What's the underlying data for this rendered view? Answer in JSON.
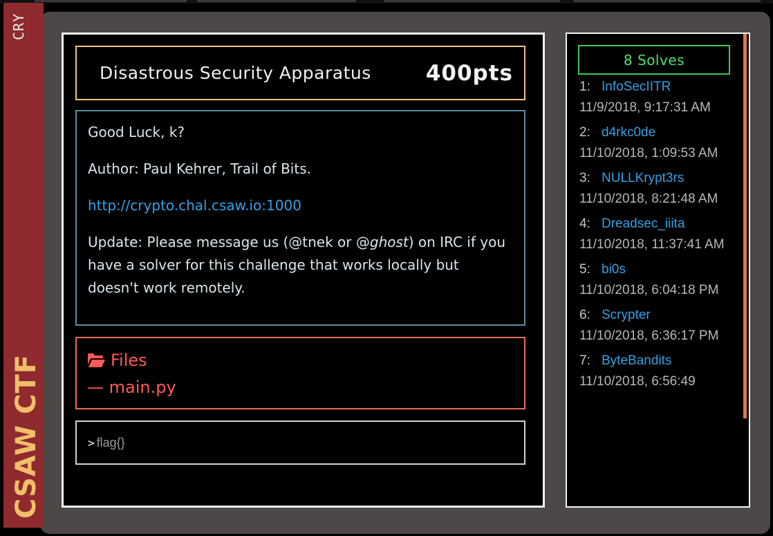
{
  "category": {
    "short": "CRY",
    "brand": "CSAW CTF"
  },
  "challenge": {
    "name": "Disastrous Security Apparatus",
    "points": "400pts",
    "description": {
      "line1": "Good Luck, k?",
      "line2": "Author: Paul Kehrer, Trail of Bits.",
      "link": "http://crypto.chal.csaw.io:1000",
      "update_before": "Update: Please message us (@tnek or @",
      "update_italic": "ghost",
      "update_after": ") on IRC if you have a solver for this challenge that works locally but doesn't work remotely."
    },
    "files": {
      "heading": "Files",
      "items": [
        "— main.py"
      ]
    },
    "flag_input": {
      "prompt": ">",
      "placeholder": "flag{}"
    }
  },
  "solves": {
    "header": "8 Solves",
    "entries": [
      {
        "rank": "1:",
        "team": "InfoSecIITR",
        "time": "11/9/2018, 9:17:31 AM"
      },
      {
        "rank": "2:",
        "team": "d4rkc0de",
        "time": "11/10/2018, 1:09:53 AM"
      },
      {
        "rank": "3:",
        "team": "NULLKrypt3rs",
        "time": "11/10/2018, 8:21:48 AM"
      },
      {
        "rank": "4:",
        "team": "Dreadsec_iiita",
        "time": "11/10/2018, 11:37:41 AM"
      },
      {
        "rank": "5:",
        "team": "bi0s",
        "time": "11/10/2018, 6:04:18 PM"
      },
      {
        "rank": "6:",
        "team": "Scrypter",
        "time": "11/10/2018, 6:36:17 PM"
      },
      {
        "rank": "7:",
        "team": "ByteBandits",
        "time": "11/10/2018, 6:56:49"
      }
    ]
  },
  "colors": {
    "title_border": "#f1c573",
    "desc_border": "#5e8da3",
    "files_accent": "#ff5a55",
    "solves_accent": "#4fe06a",
    "link": "#36a0e6",
    "category_tab": "#8f2a2e"
  },
  "icons": {
    "files": "folder-open-icon"
  }
}
